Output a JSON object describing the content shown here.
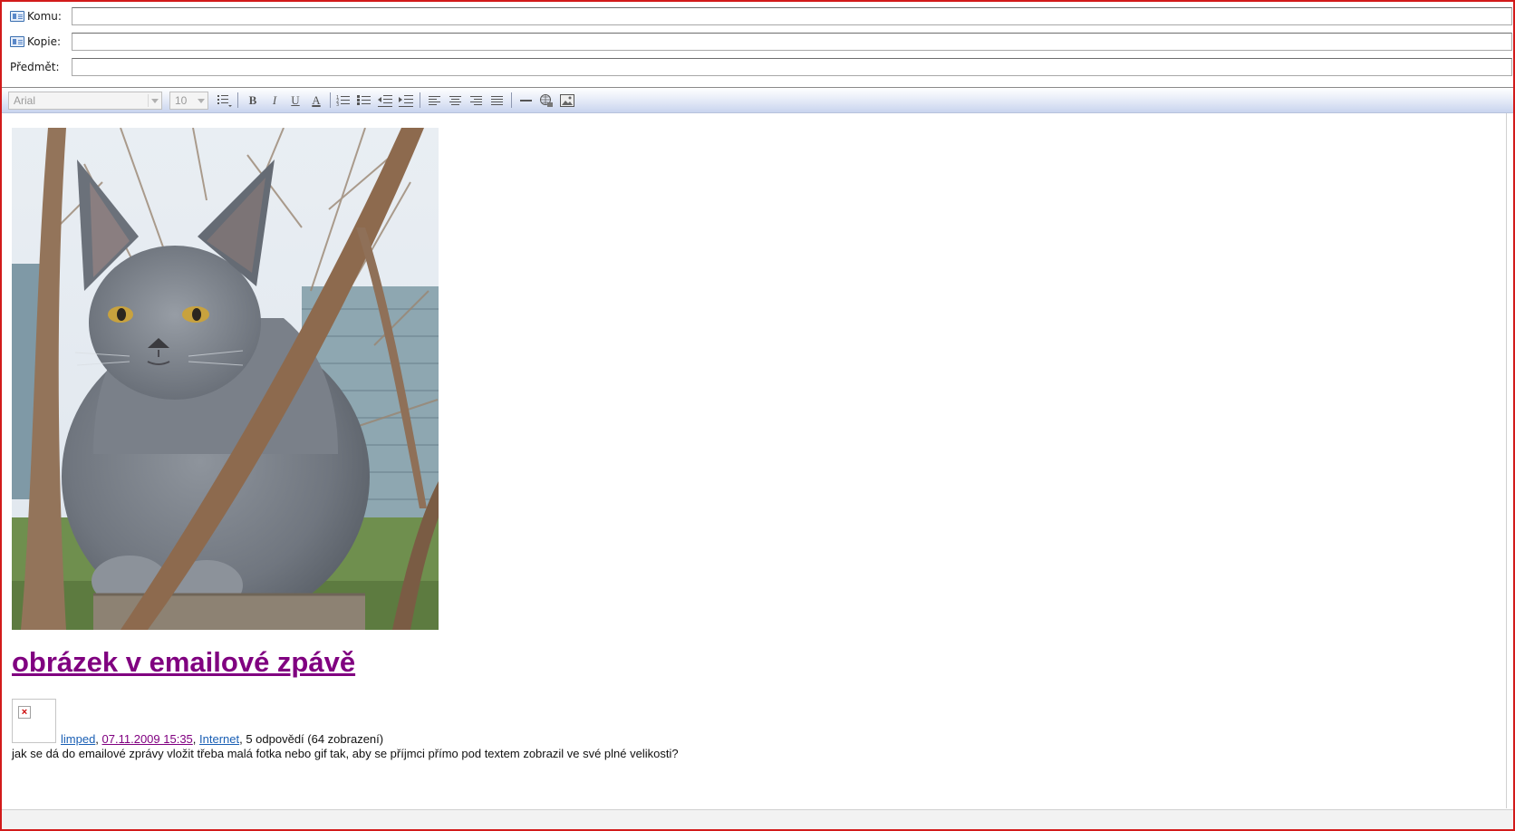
{
  "header": {
    "to_label": "Komu:",
    "to_value": "",
    "cc_label": "Kopie:",
    "cc_value": "",
    "subject_label": "Předmět:",
    "subject_value": ""
  },
  "toolbar": {
    "font_family": "Arial",
    "font_size": "10",
    "bold": "B",
    "italic": "I",
    "underline": "U",
    "font_color": "A"
  },
  "article": {
    "title": "obrázek v emailové zpávě",
    "author": "limped",
    "date": "07.11.2009 15:35",
    "category": "Internet",
    "stats": ", 5 odpovědí (64 zobrazení)",
    "body": "jak se dá do emailové zprávy vložit třeba malá fotka nebo gif tak, aby se příjmci přímo pod textem zobrazil ve své plné velikosti?"
  },
  "colors": {
    "frame": "#d21a1a",
    "title": "#800080",
    "link": "#1a5fb4",
    "toolbar_gradient_end": "#c9d4ee"
  }
}
